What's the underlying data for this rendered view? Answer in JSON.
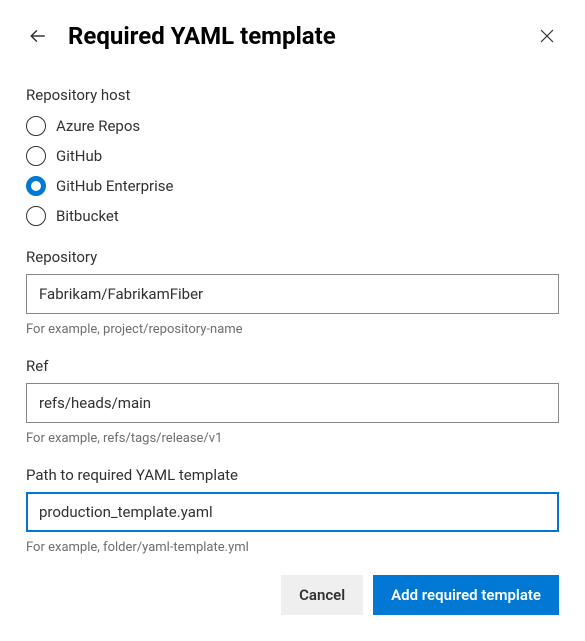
{
  "header": {
    "title": "Required YAML template"
  },
  "host": {
    "label": "Repository host",
    "options": [
      {
        "label": "Azure Repos",
        "selected": false
      },
      {
        "label": "GitHub",
        "selected": false
      },
      {
        "label": "GitHub Enterprise",
        "selected": true
      },
      {
        "label": "Bitbucket",
        "selected": false
      }
    ]
  },
  "repository": {
    "label": "Repository",
    "value": "Fabrikam/FabrikamFiber",
    "help": "For example, project/repository-name"
  },
  "ref": {
    "label": "Ref",
    "value": "refs/heads/main",
    "help": "For example, refs/tags/release/v1"
  },
  "path": {
    "label": "Path to required YAML template",
    "value": "production_template.yaml",
    "help": "For example, folder/yaml-template.yml"
  },
  "buttons": {
    "cancel": "Cancel",
    "submit": "Add required template"
  }
}
